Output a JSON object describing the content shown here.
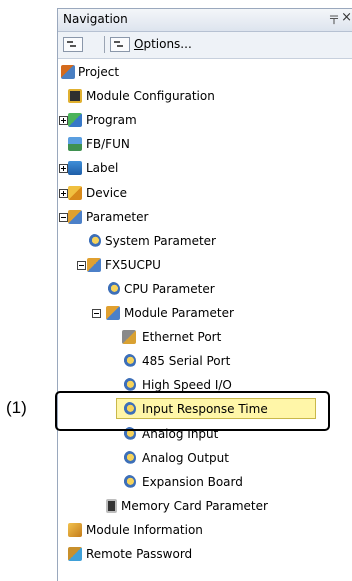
{
  "pane": {
    "title": "Navigation",
    "pin_glyph": "〒",
    "close_glyph": "×"
  },
  "toolbar": {
    "options_accel": "O",
    "options_rest": "ptions..."
  },
  "tree": [
    {
      "label": "Project",
      "icon": "project-icon"
    },
    {
      "label": "Module Configuration",
      "icon": "module-configuration-icon"
    },
    {
      "label": "Program",
      "icon": "program-icon",
      "expander": "plus"
    },
    {
      "label": "FB/FUN",
      "icon": "fb-fun-icon"
    },
    {
      "label": "Label",
      "icon": "label-icon",
      "expander": "plus"
    },
    {
      "label": "Device",
      "icon": "device-icon",
      "expander": "plus"
    },
    {
      "label": "Parameter",
      "icon": "parameter-icon",
      "expander": "minus"
    },
    {
      "label": "System Parameter",
      "icon": "system-parameter-icon"
    },
    {
      "label": "FX5UCPU",
      "icon": "cpu-icon",
      "expander": "minus"
    },
    {
      "label": "CPU Parameter",
      "icon": "cpu-parameter-icon"
    },
    {
      "label": "Module Parameter",
      "icon": "module-parameter-icon",
      "expander": "minus"
    },
    {
      "label": "Ethernet Port",
      "icon": "ethernet-port-icon"
    },
    {
      "label": "485 Serial Port",
      "icon": "serial-port-icon"
    },
    {
      "label": "High Speed I/O",
      "icon": "high-speed-io-icon"
    },
    {
      "label": "Input Response Time",
      "icon": "input-response-time-icon",
      "selected": true
    },
    {
      "label": "Analog Input",
      "icon": "analog-input-icon"
    },
    {
      "label": "Analog Output",
      "icon": "analog-output-icon"
    },
    {
      "label": "Expansion Board",
      "icon": "expansion-board-icon"
    },
    {
      "label": "Memory Card Parameter",
      "icon": "memory-card-icon"
    },
    {
      "label": "Module Information",
      "icon": "module-information-icon"
    },
    {
      "label": "Remote Password",
      "icon": "remote-password-icon"
    }
  ],
  "callout": {
    "label": "(1)"
  },
  "colors": {
    "highlight": "#fff6a8",
    "pane_bg": "#e8edf4"
  }
}
